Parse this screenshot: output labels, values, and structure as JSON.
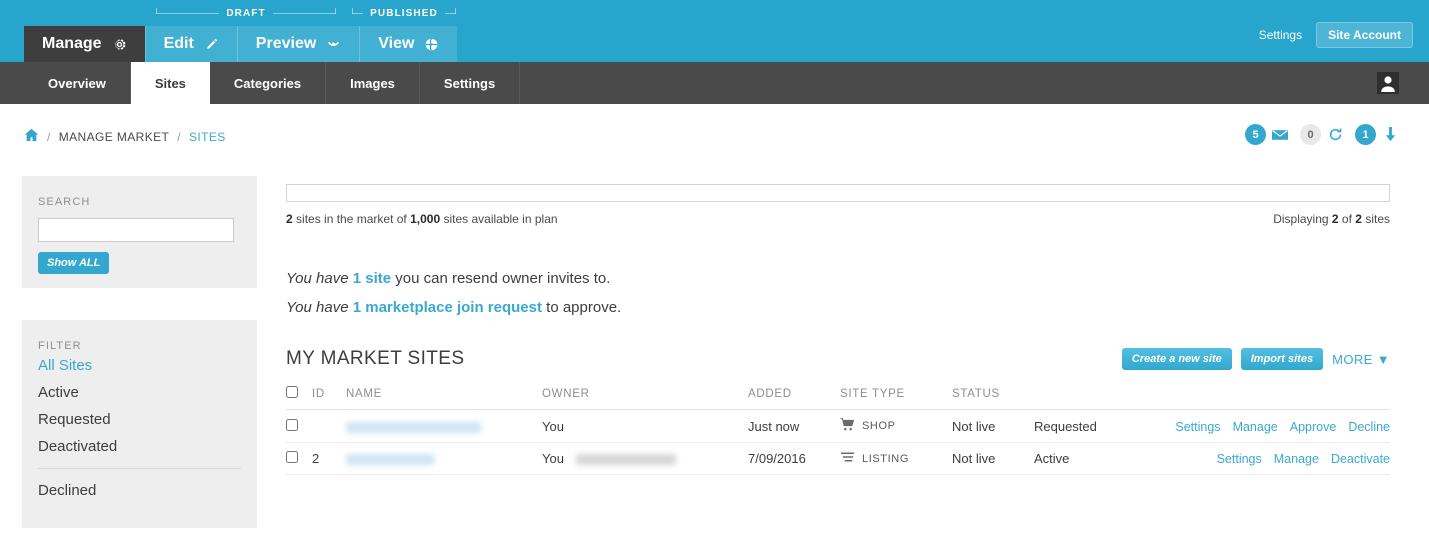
{
  "topbar": {
    "stages": [
      {
        "label": "DRAFT"
      },
      {
        "label": "PUBLISHED"
      }
    ],
    "tabs": [
      {
        "label": "Manage",
        "icon": "gear-icon",
        "active": true
      },
      {
        "label": "Edit",
        "icon": "pencil-icon",
        "active": false
      },
      {
        "label": "Preview",
        "icon": "eye-icon",
        "active": false
      },
      {
        "label": "View",
        "icon": "globe-icon",
        "active": false
      }
    ],
    "settings_link": "Settings",
    "site_account_button": "Site Account",
    "accent_color": "#27a5cc",
    "active_tab_color": "#3e3e3e"
  },
  "subnav": {
    "tabs": [
      {
        "label": "Overview",
        "active": false
      },
      {
        "label": "Sites",
        "active": true
      },
      {
        "label": "Categories",
        "active": false
      },
      {
        "label": "Images",
        "active": false
      },
      {
        "label": "Settings",
        "active": false
      }
    ],
    "avatar_icon": "user-avatar-icon"
  },
  "breadcrumb": {
    "home_icon": "home-icon",
    "items": [
      {
        "label": "MANAGE MARKET",
        "current": false
      },
      {
        "label": "SITES",
        "current": true
      }
    ],
    "separator": "/"
  },
  "badges": [
    {
      "count": "5",
      "icon": "envelope-icon",
      "style": "blue"
    },
    {
      "count": "0",
      "icon": "refresh-icon",
      "style": "gray"
    },
    {
      "count": "1",
      "icon": "download-arrow-icon",
      "style": "blue"
    }
  ],
  "sidebar": {
    "search_label": "SEARCH",
    "search_value": "",
    "search_placeholder": "",
    "show_all_button": "Show ALL",
    "filter_label": "FILTER",
    "filters": [
      {
        "label": "All Sites",
        "active": true
      },
      {
        "label": "Active",
        "active": false
      },
      {
        "label": "Requested",
        "active": false
      },
      {
        "label": "Deactivated",
        "active": false
      },
      {
        "label": "Declined",
        "active": false
      }
    ]
  },
  "quota": {
    "progress_percent": 0.2,
    "used_count": "2",
    "text_middle": "sites in the market of",
    "plan_count": "1,000",
    "text_end": "sites available in plan",
    "displaying_prefix": "Displaying",
    "displaying_shown": "2",
    "displaying_of": "of",
    "displaying_total": "2",
    "displaying_suffix": "sites"
  },
  "notices": [
    {
      "lead": "You have",
      "link": "1 site",
      "tail": "you can resend owner invites to."
    },
    {
      "lead": "You have",
      "link": "1 marketplace join request",
      "tail": "to approve."
    }
  ],
  "section": {
    "title": "MY MARKET SITES",
    "create_button": "Create a new site",
    "import_button": "Import sites",
    "more_label": "MORE",
    "more_caret": "▼"
  },
  "table": {
    "columns": [
      "ID",
      "NAME",
      "OWNER",
      "ADDED",
      "SITE TYPE",
      "STATUS"
    ],
    "rows": [
      {
        "id": "",
        "name": "",
        "name_redacted": true,
        "owner": "You",
        "owner_extra_redacted": false,
        "added": "Just now",
        "site_type": "SHOP",
        "site_type_icon": "shopping-cart-icon",
        "status": "Not live",
        "state": "Requested",
        "state_style": "normal",
        "actions": [
          "Settings",
          "Manage",
          "Approve",
          "Decline"
        ]
      },
      {
        "id": "2",
        "name": "",
        "name_redacted": true,
        "owner": "You",
        "owner_extra_redacted": true,
        "added": "7/09/2016",
        "site_type": "LISTING",
        "site_type_icon": "list-lines-icon",
        "status": "Not live",
        "state": "Active",
        "state_style": "active",
        "actions": [
          "Settings",
          "Manage",
          "Deactivate"
        ]
      }
    ]
  }
}
